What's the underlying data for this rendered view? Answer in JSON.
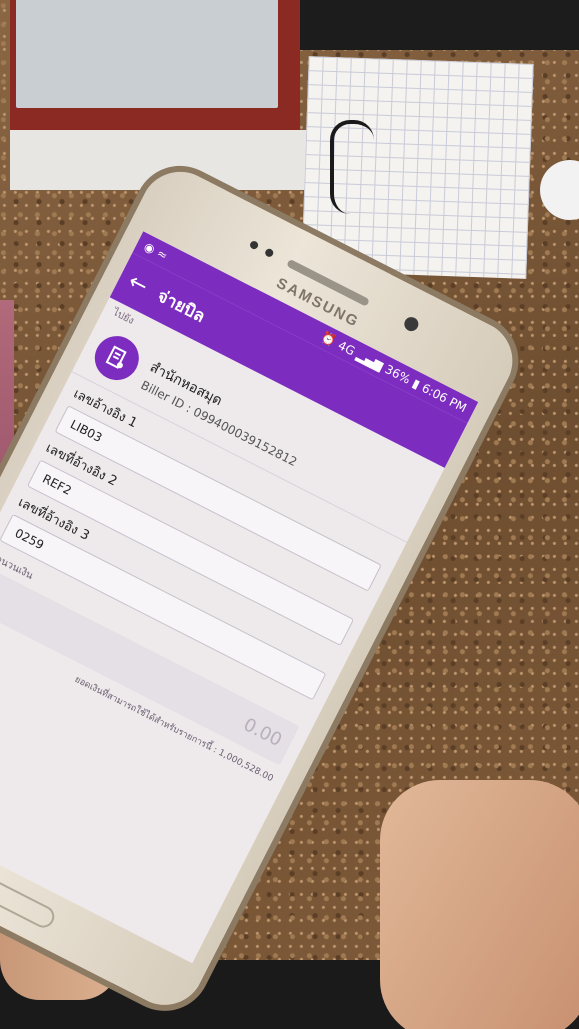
{
  "status_bar": {
    "left_icons": [
      "messenger-icon",
      "wifi-icon"
    ],
    "network": "4G",
    "battery": "36%",
    "time": "6:06 PM"
  },
  "device": {
    "brand": "SAMSUNG"
  },
  "app_bar": {
    "title": "จ่ายบิล"
  },
  "form": {
    "to_label": "ไปยัง",
    "biller": {
      "name": "สำนักหอสมุด",
      "biller_id": "Biller ID : 099400039152812"
    },
    "fields": [
      {
        "label": "เลขอ้างอิง 1",
        "value": "LIB03"
      },
      {
        "label": "เลขที่อ้างอิง 2",
        "value": "REF2"
      },
      {
        "label": "เลขที่อ้างอิง 3",
        "value": "0259"
      }
    ],
    "amount_label": "จำนวนเงิน",
    "amount_placeholder": "0.00",
    "balance_note": "ยอดเงินที่สามารถใช้ได้สำหรับรายการนี้ : 1,000,528.00"
  }
}
